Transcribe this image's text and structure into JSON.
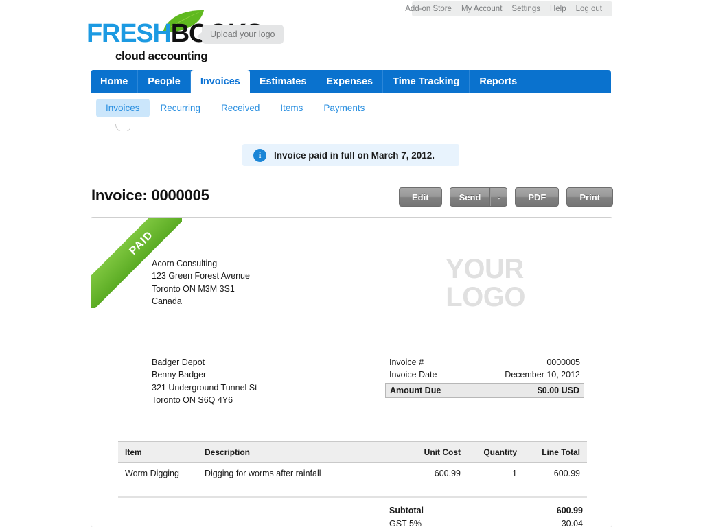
{
  "utility_nav": {
    "items": [
      {
        "label": "Add-on Store",
        "name": "addon-store"
      },
      {
        "label": "My Account",
        "name": "my-account"
      },
      {
        "label": "Settings",
        "name": "settings"
      },
      {
        "label": "Help",
        "name": "help"
      },
      {
        "label": "Log out",
        "name": "log-out"
      }
    ]
  },
  "brand": {
    "part1": "FRE",
    "part2": "SH",
    "part3": "BOOKS",
    "tagline": "cloud accounting",
    "upload_logo": "Upload your logo"
  },
  "main_nav": {
    "tabs": [
      {
        "label": "Home",
        "active": false
      },
      {
        "label": "People",
        "active": false
      },
      {
        "label": "Invoices",
        "active": true
      },
      {
        "label": "Estimates",
        "active": false
      },
      {
        "label": "Expenses",
        "active": false
      },
      {
        "label": "Time Tracking",
        "active": false
      },
      {
        "label": "Reports",
        "active": false
      }
    ]
  },
  "sub_nav": {
    "items": [
      {
        "label": "Invoices",
        "active": true
      },
      {
        "label": "Recurring",
        "active": false
      },
      {
        "label": "Received",
        "active": false
      },
      {
        "label": "Items",
        "active": false
      },
      {
        "label": "Payments",
        "active": false
      }
    ]
  },
  "banner": {
    "icon": "info-icon",
    "text": "Invoice paid in full on March 7, 2012."
  },
  "page": {
    "title": "Invoice: 0000005"
  },
  "actions": {
    "edit": "Edit",
    "send": "Send",
    "send_caret": "⌄",
    "pdf": "PDF",
    "print": "Print"
  },
  "invoice": {
    "status_ribbon": "PAID",
    "logo_placeholder_line1": "YOUR",
    "logo_placeholder_line2": "LOGO",
    "from": [
      "Acorn Consulting",
      "123 Green Forest Avenue",
      "Toronto ON  M3M 3S1",
      "Canada"
    ],
    "to": [
      "Badger Depot",
      "Benny Badger",
      "321 Underground Tunnel St",
      "Toronto ON  S6Q 4Y6"
    ],
    "meta": [
      {
        "label": "Invoice #",
        "value": "0000005"
      },
      {
        "label": "Invoice Date",
        "value": "December 10, 2012"
      }
    ],
    "amount_due": {
      "label": "Amount Due",
      "value": "$0.00 USD"
    },
    "table": {
      "headers": [
        "Item",
        "Description",
        "Unit Cost",
        "Quantity",
        "Line Total"
      ],
      "rows": [
        {
          "item": "Worm Digging",
          "description": "Digging for worms after rainfall",
          "unit_cost": "600.99",
          "quantity": "1",
          "line_total": "600.99"
        }
      ]
    },
    "totals": [
      {
        "label": "Subtotal",
        "value": "600.99",
        "bold": true
      },
      {
        "label": "GST 5%",
        "value": "30.04",
        "bold": false
      }
    ]
  },
  "colors": {
    "nav_blue": "#0a72ce",
    "link_blue": "#2a8fe0",
    "active_tab_text": "#0d73d4",
    "subnav_active_bg": "#cbe6fb",
    "banner_bg": "#e8f3fd",
    "ribbon_green": "#5aab23",
    "button_gray": "#8d8d8d",
    "table_header_bg": "#eeeeee",
    "amount_due_bg": "#e9e9e9"
  }
}
